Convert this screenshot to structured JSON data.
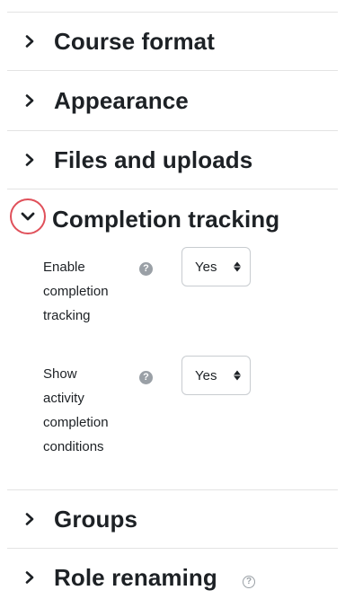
{
  "sections": {
    "course_format": {
      "title": "Course format",
      "icon": "chevron-right-icon"
    },
    "appearance": {
      "title": "Appearance",
      "icon": "chevron-right-icon"
    },
    "files_uploads": {
      "title": "Files and uploads",
      "icon": "chevron-right-icon"
    },
    "completion_tracking": {
      "title": "Completion tracking",
      "icon": "chevron-down-icon",
      "expanded": true,
      "highlight_color": "#e0505a",
      "fields": {
        "enable_completion": {
          "label_lines": [
            "Enable",
            "completion",
            "tracking"
          ],
          "help_icon": "help-icon",
          "value": "Yes"
        },
        "show_conditions": {
          "label_lines": [
            "Show",
            "activity",
            "completion",
            "conditions"
          ],
          "help_icon": "help-icon",
          "value": "Yes"
        }
      }
    },
    "groups": {
      "title": "Groups",
      "icon": "chevron-right-icon"
    },
    "role_renaming": {
      "title": "Role renaming",
      "icon": "chevron-right-icon",
      "help_icon": "help-icon"
    }
  }
}
